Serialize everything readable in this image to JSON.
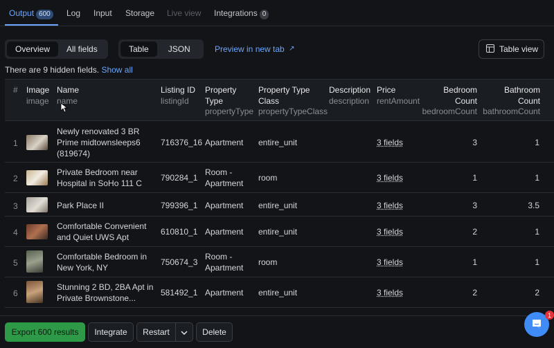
{
  "tabs": [
    {
      "label": "Output",
      "badge": "600"
    },
    {
      "label": "Log"
    },
    {
      "label": "Input"
    },
    {
      "label": "Storage"
    },
    {
      "label": "Live view"
    },
    {
      "label": "Integrations",
      "badge": "0"
    }
  ],
  "toolbar": {
    "overview": "Overview",
    "all_fields": "All fields",
    "table": "Table",
    "json": "JSON",
    "preview": "Preview in new tab",
    "preview_icon": "external-link-icon",
    "table_view": "Table view"
  },
  "hidden_note": {
    "text": "There are 9 hidden fields.",
    "link": "Show all"
  },
  "columns": [
    {
      "title": "#",
      "sub": ""
    },
    {
      "title": "Image",
      "sub": "image"
    },
    {
      "title": "Name",
      "sub": "name"
    },
    {
      "title": "Listing ID",
      "sub": "listingId"
    },
    {
      "title": "Property Type",
      "sub": "propertyType"
    },
    {
      "title": "Property Type Class",
      "sub": "propertyTypeClass"
    },
    {
      "title": "Description",
      "sub": "description"
    },
    {
      "title": "Price",
      "sub": "rentAmount"
    },
    {
      "title": "Bedroom Count",
      "sub": "bedroomCount"
    },
    {
      "title": "Bathroom Count",
      "sub": "bathroomCount"
    }
  ],
  "rows": [
    {
      "num": "1",
      "name": "Newly renovated 3 BR Prime midtownsleeps6 (819674)",
      "id": "716376_16",
      "type": "Apartment",
      "cls": "entire_unit",
      "price": "3 fields",
      "bed": "3",
      "bath": "1"
    },
    {
      "num": "2",
      "name": "Private Bedroom near Hospital in SoHo 111 C",
      "id": "790284_1",
      "type": "Room - Apartment",
      "cls": "room",
      "price": "3 fields",
      "bed": "1",
      "bath": "1"
    },
    {
      "num": "3",
      "name": "Park Place II",
      "id": "799396_1",
      "type": "Apartment",
      "cls": "entire_unit",
      "price": "3 fields",
      "bed": "3",
      "bath": "3.5"
    },
    {
      "num": "4",
      "name": "Comfortable Convenient and Quiet UWS Apt",
      "id": "610810_1",
      "type": "Apartment",
      "cls": "entire_unit",
      "price": "3 fields",
      "bed": "2",
      "bath": "1"
    },
    {
      "num": "5",
      "name": "Comfortable Bedroom in New York, NY",
      "id": "750674_3",
      "type": "Room - Apartment",
      "cls": "room",
      "price": "3 fields",
      "bed": "1",
      "bath": "1"
    },
    {
      "num": "6",
      "name": "Stunning 2 BD, 2BA Apt in Private Brownstone...",
      "id": "581492_1",
      "type": "Apartment",
      "cls": "entire_unit",
      "price": "3 fields",
      "bed": "2",
      "bath": "2"
    }
  ],
  "actions": {
    "export": "Export 600 results",
    "integrate": "Integrate",
    "restart": "Restart",
    "delete": "Delete"
  },
  "chat": {
    "badge": "1"
  },
  "colors": {
    "accent": "#6aa7ff",
    "primary": "#2e9a47",
    "bg": "#121418"
  }
}
